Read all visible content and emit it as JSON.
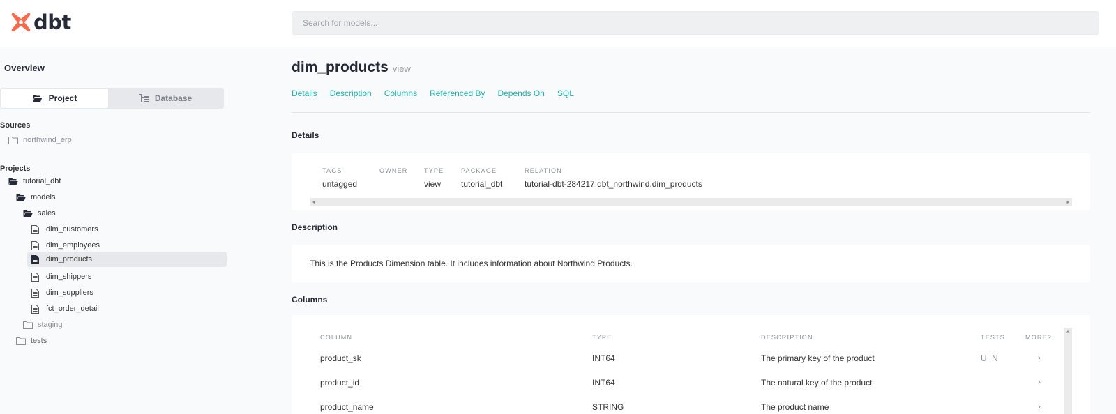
{
  "header": {
    "logo_text": "dbt",
    "search_placeholder": "Search for models..."
  },
  "sidebar": {
    "overview_label": "Overview",
    "switch": {
      "project_label": "Project",
      "database_label": "Database",
      "active": "Project"
    },
    "sources_title": "Sources",
    "sources": [
      {
        "label": "northwind_erp"
      }
    ],
    "projects_title": "Projects",
    "tree": [
      {
        "label": "tutorial_dbt"
      },
      {
        "label": "models"
      },
      {
        "label": "sales"
      },
      {
        "label": "dim_customers"
      },
      {
        "label": "dim_employees"
      },
      {
        "label": "dim_products",
        "active": true
      },
      {
        "label": "dim_shippers"
      },
      {
        "label": "dim_suppliers"
      },
      {
        "label": "fct_order_detail"
      },
      {
        "label": "staging"
      },
      {
        "label": "tests"
      }
    ]
  },
  "main": {
    "title": "dim_products",
    "subtitle": "view",
    "tabs": [
      "Details",
      "Description",
      "Columns",
      "Referenced By",
      "Depends On",
      "SQL"
    ],
    "details": {
      "heading": "Details",
      "fields": [
        {
          "label": "TAGS",
          "value": "untagged"
        },
        {
          "label": "OWNER",
          "value": ""
        },
        {
          "label": "TYPE",
          "value": "view"
        },
        {
          "label": "PACKAGE",
          "value": "tutorial_dbt"
        },
        {
          "label": "RELATION",
          "value": "tutorial-dbt-284217.dbt_northwind.dim_products"
        }
      ]
    },
    "description": {
      "heading": "Description",
      "text": "This is the Products Dimension table. It includes information about Northwind Products."
    },
    "columns": {
      "heading": "Columns",
      "headers": [
        "COLUMN",
        "TYPE",
        "DESCRIPTION",
        "TESTS",
        "MORE?"
      ],
      "rows": [
        {
          "column": "product_sk",
          "type": "INT64",
          "description": "The primary key of the product",
          "tests": "U N",
          "more": "›"
        },
        {
          "column": "product_id",
          "type": "INT64",
          "description": "The natural key of the product",
          "tests": "",
          "more": "›"
        },
        {
          "column": "product_name",
          "type": "STRING",
          "description": "The product name",
          "tests": "",
          "more": "›"
        }
      ]
    }
  },
  "colors": {
    "accent": "#17b8b0",
    "brand": "#ff694a",
    "text": "#262a38"
  }
}
